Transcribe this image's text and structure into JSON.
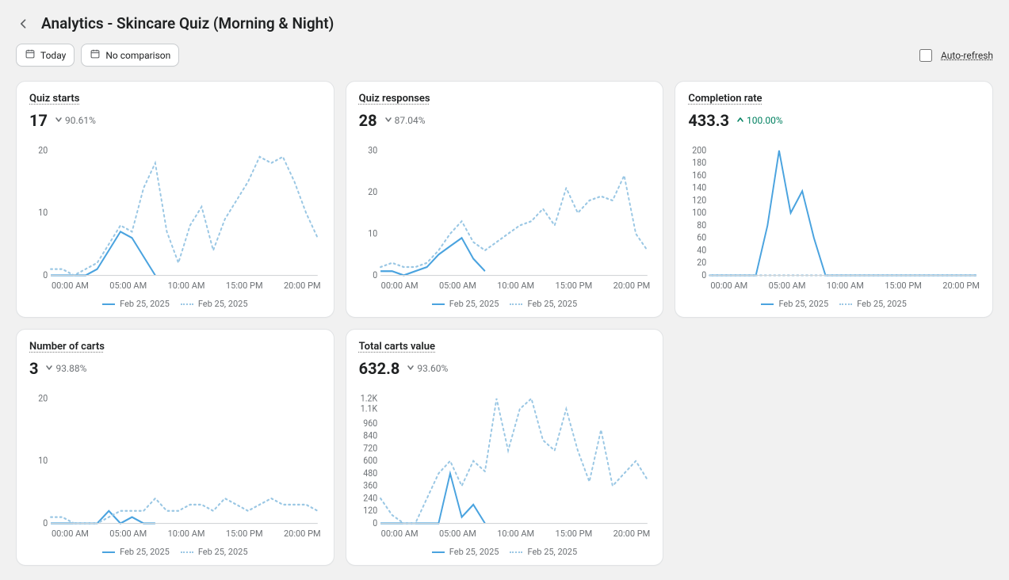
{
  "header": {
    "title": "Analytics - Skincare Quiz (Morning & Night)"
  },
  "filters": {
    "date_label": "Today",
    "comparison_label": "No comparison"
  },
  "auto_refresh": {
    "label": "Auto-refresh",
    "checked": false
  },
  "legend": {
    "current": "Feb 25, 2025",
    "comparison": "Feb 25, 2025"
  },
  "xaxis_labels": [
    "00:00 AM",
    "05:00 AM",
    "10:00 AM",
    "15:00 PM",
    "20:00 PM"
  ],
  "cards": [
    {
      "id": "quiz-starts",
      "title": "Quiz starts",
      "value": "17",
      "delta": "90.61%",
      "trend": "down",
      "has_comparison": true
    },
    {
      "id": "quiz-responses",
      "title": "Quiz responses",
      "value": "28",
      "delta": "87.04%",
      "trend": "down",
      "has_comparison": true
    },
    {
      "id": "completion-rate",
      "title": "Completion rate",
      "value": "433.3",
      "delta": "100.00%",
      "trend": "up",
      "has_comparison": true
    },
    {
      "id": "number-of-carts",
      "title": "Number of carts",
      "value": "3",
      "delta": "93.88%",
      "trend": "down",
      "has_comparison": true
    },
    {
      "id": "total-carts-value",
      "title": "Total carts value",
      "value": "632.8",
      "delta": "93.60%",
      "trend": "down",
      "has_comparison": true
    }
  ],
  "chart_data": [
    {
      "card_id": "quiz-starts",
      "type": "line",
      "ylim": [
        0,
        20
      ],
      "yticks": [
        0,
        10,
        20
      ],
      "x": [
        0,
        1,
        2,
        3,
        4,
        5,
        6,
        7,
        8,
        9,
        10,
        11,
        12,
        13,
        14,
        15,
        16,
        17,
        18,
        19,
        20,
        21,
        22,
        23
      ],
      "series": [
        {
          "name": "Feb 25, 2025",
          "style": "solid",
          "values": [
            0,
            0,
            0,
            0,
            1,
            4,
            7,
            6,
            3,
            0
          ]
        },
        {
          "name": "Feb 25, 2025",
          "style": "dotted",
          "values": [
            1,
            1,
            0,
            1,
            2,
            5,
            8,
            7,
            14,
            18,
            7,
            2,
            8,
            11,
            4,
            9,
            12,
            15,
            19,
            18,
            19,
            15,
            10,
            6
          ]
        }
      ]
    },
    {
      "card_id": "quiz-responses",
      "type": "line",
      "ylim": [
        0,
        30
      ],
      "yticks": [
        0,
        10,
        20,
        30
      ],
      "x": [
        0,
        1,
        2,
        3,
        4,
        5,
        6,
        7,
        8,
        9,
        10,
        11,
        12,
        13,
        14,
        15,
        16,
        17,
        18,
        19,
        20,
        21,
        22,
        23
      ],
      "series": [
        {
          "name": "Feb 25, 2025",
          "style": "solid",
          "values": [
            1,
            1,
            0,
            1,
            2,
            5,
            7,
            9,
            4,
            1
          ]
        },
        {
          "name": "Feb 25, 2025",
          "style": "dotted",
          "values": [
            2,
            3,
            2,
            2,
            3,
            6,
            10,
            13,
            8,
            6,
            8,
            10,
            12,
            13,
            16,
            12,
            21,
            15,
            18,
            19,
            18,
            24,
            10,
            6
          ]
        }
      ]
    },
    {
      "card_id": "completion-rate",
      "type": "line",
      "ylim": [
        0,
        200
      ],
      "yticks": [
        0,
        20,
        40,
        60,
        80,
        100,
        120,
        140,
        160,
        180,
        200
      ],
      "x": [
        0,
        1,
        2,
        3,
        4,
        5,
        6,
        7,
        8,
        9,
        10,
        11,
        12,
        13,
        14,
        15,
        16,
        17,
        18,
        19,
        20,
        21,
        22,
        23
      ],
      "series": [
        {
          "name": "Feb 25, 2025",
          "style": "solid",
          "values": [
            0,
            0,
            0,
            0,
            0,
            80,
            200,
            100,
            135,
            60,
            0,
            0,
            0,
            0,
            0,
            0,
            0,
            0,
            0,
            0,
            0,
            0,
            0,
            0
          ]
        },
        {
          "name": "Feb 25, 2025",
          "style": "dotted",
          "values": [
            0,
            0,
            0,
            0,
            0,
            0,
            0,
            0,
            0,
            0,
            0,
            0,
            0,
            0,
            0,
            0,
            0,
            0,
            0,
            0,
            0,
            0,
            0,
            0
          ]
        }
      ]
    },
    {
      "card_id": "number-of-carts",
      "type": "line",
      "ylim": [
        0,
        20
      ],
      "yticks": [
        0,
        10,
        20
      ],
      "x": [
        0,
        1,
        2,
        3,
        4,
        5,
        6,
        7,
        8,
        9,
        10,
        11,
        12,
        13,
        14,
        15,
        16,
        17,
        18,
        19,
        20,
        21,
        22,
        23
      ],
      "series": [
        {
          "name": "Feb 25, 2025",
          "style": "solid",
          "values": [
            0,
            0,
            0,
            0,
            0,
            2,
            0,
            1,
            0,
            0
          ]
        },
        {
          "name": "Feb 25, 2025",
          "style": "dotted",
          "values": [
            1,
            1,
            0,
            0,
            0,
            1,
            2,
            2,
            2,
            4,
            2,
            2,
            3,
            3,
            2,
            4,
            3,
            2,
            3,
            4,
            3,
            3,
            3,
            2
          ]
        }
      ]
    },
    {
      "card_id": "total-carts-value",
      "type": "line",
      "ylim": [
        0,
        1200
      ],
      "yticks": [
        0,
        120,
        240,
        360,
        480,
        600,
        720,
        840,
        960,
        1100,
        1200
      ],
      "ytick_labels": [
        "0",
        "120",
        "240",
        "360",
        "480",
        "600",
        "720",
        "840",
        "960",
        "1.1K",
        "1.2K"
      ],
      "x": [
        0,
        1,
        2,
        3,
        4,
        5,
        6,
        7,
        8,
        9,
        10,
        11,
        12,
        13,
        14,
        15,
        16,
        17,
        18,
        19,
        20,
        21,
        22,
        23
      ],
      "series": [
        {
          "name": "Feb 25, 2025",
          "style": "solid",
          "values": [
            0,
            0,
            0,
            0,
            0,
            0,
            480,
            60,
            180,
            0
          ]
        },
        {
          "name": "Feb 25, 2025",
          "style": "dotted",
          "values": [
            240,
            80,
            0,
            0,
            240,
            480,
            600,
            360,
            600,
            500,
            1200,
            700,
            1100,
            1200,
            800,
            700,
            1100,
            700,
            400,
            900,
            360,
            480,
            600,
            420
          ]
        }
      ]
    }
  ]
}
